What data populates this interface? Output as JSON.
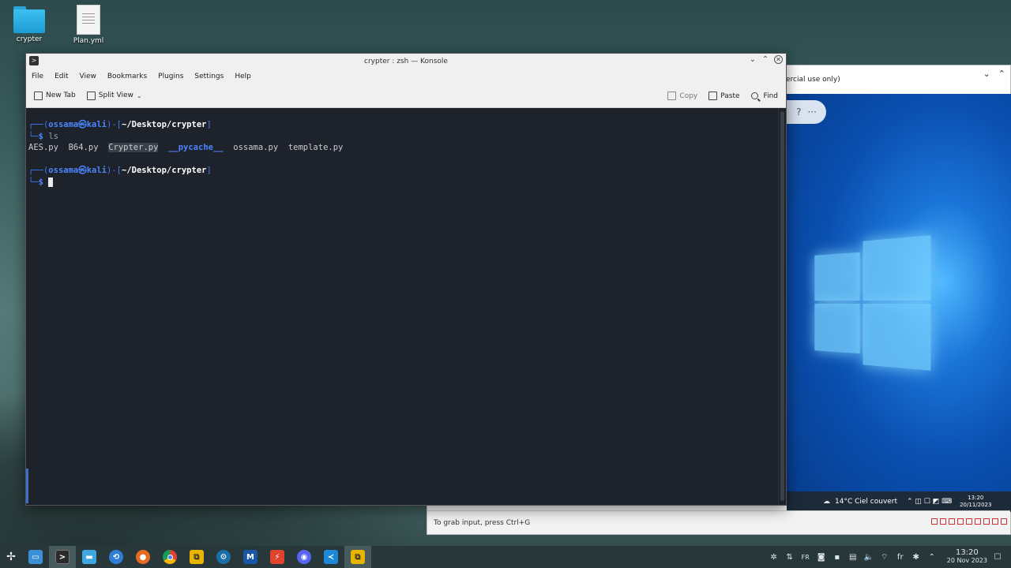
{
  "desktop": {
    "icons": [
      {
        "label": "crypter",
        "icon": "folder-icon"
      },
      {
        "label": "Plan.yml",
        "icon": "document-icon"
      }
    ]
  },
  "konsole": {
    "title": "crypter : zsh — Konsole",
    "menu": [
      "File",
      "Edit",
      "View",
      "Bookmarks",
      "Plugins",
      "Settings",
      "Help"
    ],
    "toolbar": {
      "new_tab": "New Tab",
      "split_view": "Split View",
      "copy": "Copy",
      "paste": "Paste",
      "find": "Find"
    },
    "terminal": {
      "prompt_open": "┌──(",
      "user": "ossama",
      "at": "㉿",
      "host": "kali",
      "prompt_mid": ")-[",
      "cwd": "~/Desktop/crypter",
      "prompt_close": "]",
      "prompt_second": "└─",
      "dollar": "$",
      "command": "ls",
      "files": [
        "AES.py",
        "B64.py",
        "Crypter.py",
        "__pycache__",
        "ossama.py",
        "template.py"
      ]
    }
  },
  "vm_window": {
    "title_fragment": "ercial use only)",
    "status_hint": "To grab input, press Ctrl+G",
    "guest_taskbar": {
      "weather": "14°C  Ciel couvert",
      "time": "13:20",
      "date": "20/11/2023"
    }
  },
  "taskbar": {
    "apps": [
      {
        "name": "app-launcher-icon"
      },
      {
        "name": "konsole-icon"
      },
      {
        "name": "file-manager-icon"
      },
      {
        "name": "kali-icon"
      },
      {
        "name": "firefox-icon"
      },
      {
        "name": "chrome-icon"
      },
      {
        "name": "vmware-icon"
      },
      {
        "name": "steam-icon"
      },
      {
        "name": "metasploit-icon"
      },
      {
        "name": "burp-icon"
      },
      {
        "name": "discord-icon"
      },
      {
        "name": "vscode-icon"
      },
      {
        "name": "vmware-icon"
      }
    ],
    "tray": {
      "keyboard_layout": "FR",
      "language": "fr",
      "time": "13:20",
      "date": "20 Nov 2023"
    }
  },
  "colors": {
    "terminal_bg": "#1e222a",
    "prompt_blue": "#3e7cf2",
    "directory_blue": "#4a86ff"
  }
}
